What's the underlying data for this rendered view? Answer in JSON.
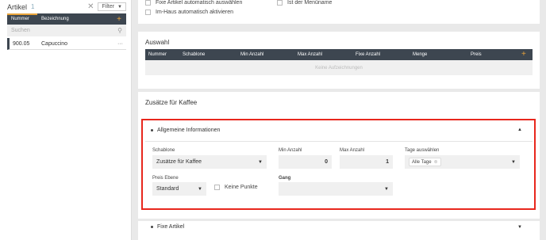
{
  "left": {
    "title": "Artikel",
    "count": "1",
    "filter_label": "Filter",
    "col_number": "Nummer",
    "col_name": "Bezeichnung",
    "search_placeholder": "Suchen",
    "rows": [
      {
        "number": "900.05",
        "name": "Capuccino"
      }
    ]
  },
  "top_options": {
    "auto_select": "Fixe Artikel automatisch auswählen",
    "inhouse": "Im-Haus automatisch aktivieren",
    "is_menu": "Ist der Menüname"
  },
  "auswahl": {
    "title": "Auswahl",
    "columns": [
      "Nummer",
      "Schablone",
      "Min Anzahl",
      "Max Anzahl",
      "Fixe Anzahl",
      "Menge",
      "Preis"
    ],
    "empty_text": "Keine Aufzeichnungen"
  },
  "zusaetze": {
    "title": "Zusätze für Kaffee",
    "section_title": "Allgemeine Informationen",
    "schablone_label": "Schablone",
    "schablone_value": "Zusätze für Kaffee",
    "min_label": "Min Anzahl",
    "min_value": "0",
    "max_label": "Max Anzahl",
    "max_value": "1",
    "tage_label": "Tage auswählen",
    "tage_value": "Alle Tage",
    "preis_label": "Preis Ebene",
    "preis_value": "Standard",
    "keine_punkte": "Keine Punkte",
    "gang_label": "Gang",
    "gang_value": ""
  },
  "fixe": {
    "title": "Fixe Artikel"
  },
  "colors": {
    "accent": "#e8a33a",
    "header_dark": "#3d4650",
    "highlight": "#e8271d"
  }
}
